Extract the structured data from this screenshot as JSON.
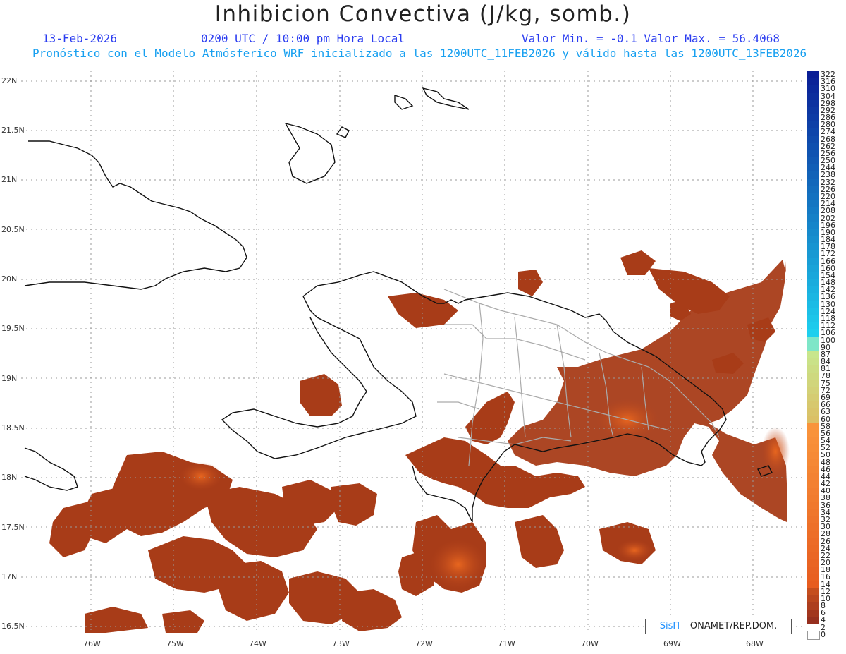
{
  "title": "Inhibicion Convectiva (J/kg, somb.)",
  "header": {
    "date": "13-Feb-2026",
    "time": "0200 UTC / 10:00 pm Hora Local",
    "minmax": "Valor Min. = -0.1  Valor Max. = 56.4068",
    "subtitle": "Pronóstico con el Modelo Atmósferico WRF inicializado a las 1200UTC_11FEB2026 y válido hasta las  1200UTC_13FEB2026"
  },
  "lat_labels": [
    "22N",
    "21.5N",
    "21N",
    "20.5N",
    "20N",
    "19.5N",
    "19N",
    "18.5N",
    "18N",
    "17.5N",
    "17N",
    "16.5N"
  ],
  "lon_labels": [
    "76W",
    "75W",
    "74W",
    "73W",
    "72W",
    "71W",
    "70W",
    "69W",
    "68W"
  ],
  "colorbar_labels": [
    "322",
    "316",
    "310",
    "304",
    "298",
    "292",
    "286",
    "280",
    "274",
    "268",
    "262",
    "256",
    "250",
    "244",
    "238",
    "232",
    "226",
    "220",
    "214",
    "208",
    "202",
    "196",
    "190",
    "184",
    "178",
    "172",
    "166",
    "160",
    "154",
    "148",
    "142",
    "136",
    "130",
    "124",
    "118",
    "112",
    "106",
    "100",
    "90",
    "87",
    "84",
    "81",
    "78",
    "75",
    "72",
    "69",
    "66",
    "63",
    "60",
    "58",
    "56",
    "54",
    "52",
    "50",
    "48",
    "46",
    "44",
    "42",
    "40",
    "38",
    "36",
    "34",
    "32",
    "30",
    "28",
    "26",
    "24",
    "22",
    "20",
    "18",
    "16",
    "14",
    "12",
    "10",
    "8",
    "6",
    "4",
    "2",
    "0"
  ],
  "credit": {
    "brand": "SisΠ",
    "text": "– ONAMET/REP.DOM."
  },
  "colors": {
    "field_dark": "#9c3414",
    "field_mid": "#b8451c",
    "field_light": "#e0621e",
    "coast": "#111111",
    "borders": "#aaaaaa",
    "grid": "#9a9a9a"
  }
}
